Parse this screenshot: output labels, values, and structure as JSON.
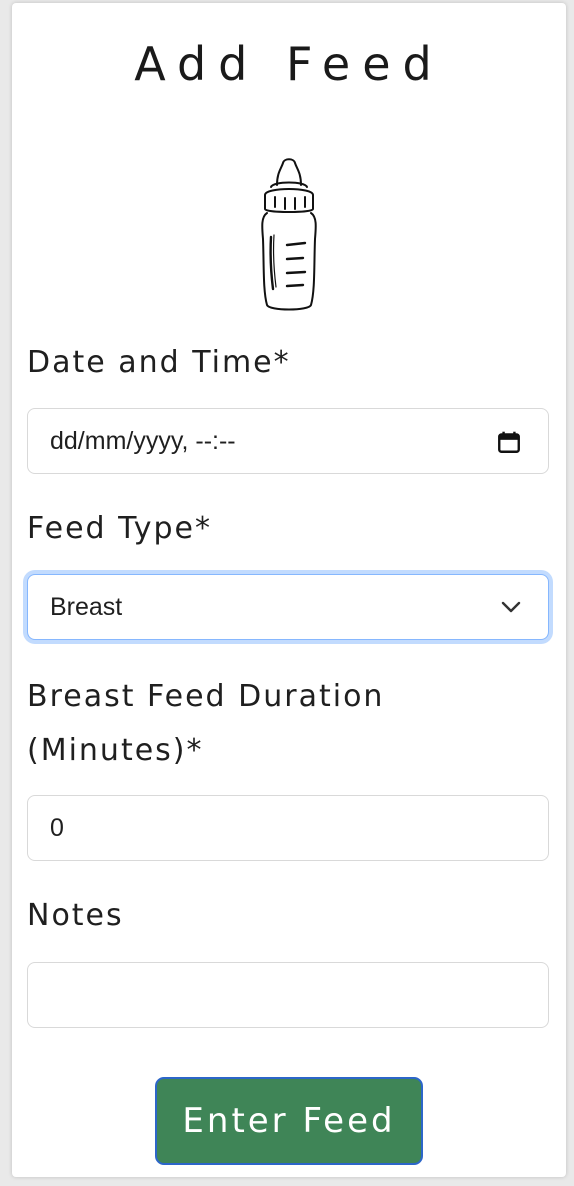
{
  "form": {
    "title": "Add Feed",
    "icon": "baby-bottle-icon",
    "datetime": {
      "label": "Date and Time*",
      "placeholder": "dd/mm/yyyy, --:--",
      "icon": "calendar-icon"
    },
    "feed_type": {
      "label": "Feed Type*",
      "value": "Breast",
      "icon": "chevron-down-icon"
    },
    "duration": {
      "label_line1": "Breast Feed Duration",
      "label_line2": "(Minutes)*",
      "value": "0"
    },
    "notes": {
      "label": "Notes",
      "value": ""
    },
    "submit_label": "Enter Feed"
  },
  "colors": {
    "submit_bg": "#3f8557",
    "submit_border": "#2c66c9",
    "focus_ring": "#86b7fe"
  }
}
